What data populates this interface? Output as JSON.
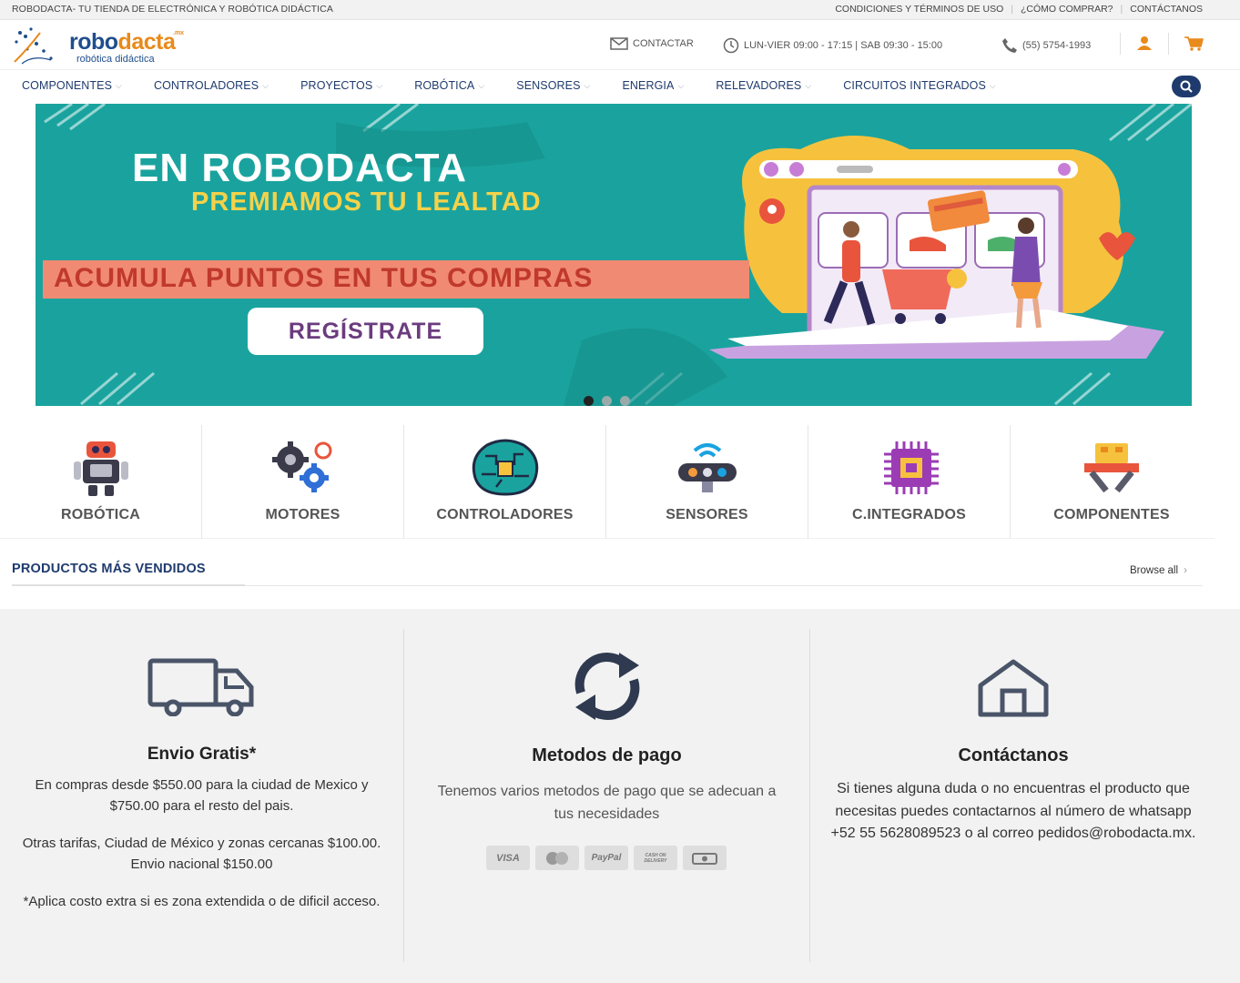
{
  "topbar": {
    "tagline": "ROBODACTA- TU TIENDA DE ELECTRÓNICA Y ROBÓTICA DIDÁCTICA",
    "links": [
      "CONDICIONES Y TÉRMINOS DE USO",
      "¿CÓMO COMPRAR?",
      "CONTÁCTANOS"
    ]
  },
  "header": {
    "logo_word_a": "robo",
    "logo_word_b": "dacta",
    "logo_tld": ".mx",
    "logo_sub": "robótica didáctica",
    "contact_label": "CONTACTAR",
    "hours": "LUN-VIER 09:00 - 17:15  | SAB 09:30 - 15:00",
    "phone": "(55) 5754-1993",
    "icons": [
      "mail-icon",
      "clock-icon",
      "phone-icon",
      "user-icon",
      "cart-icon"
    ]
  },
  "nav": {
    "items": [
      "COMPONENTES",
      "CONTROLADORES",
      "PROYECTOS",
      "ROBÓTICA",
      "SENSORES",
      "ENERGIA",
      "RELEVADORES",
      "CIRCUITOS INTEGRADOS"
    ],
    "search_icon": "search-icon"
  },
  "banner": {
    "title": "EN ROBODACTA",
    "subtitle": "PREMIAMOS TU LEALTAD",
    "strip": "ACUMULA PUNTOS EN TUS COMPRAS",
    "cta": "REGÍSTRATE",
    "slides": 3,
    "active_slide": 1,
    "colors": {
      "bg": "#1aa39e",
      "subtitle": "#f4d24a",
      "strip": "#f18a72",
      "cta_text": "#6b3c7e"
    }
  },
  "categories": [
    {
      "label": "ROBÓTICA",
      "icon": "robot-icon"
    },
    {
      "label": "MOTORES",
      "icon": "gears-icon"
    },
    {
      "label": "CONTROLADORES",
      "icon": "controller-chip-icon"
    },
    {
      "label": "SENSORES",
      "icon": "sensor-icon"
    },
    {
      "label": "C.INTEGRADOS",
      "icon": "integrated-circuit-icon"
    },
    {
      "label": "COMPONENTES",
      "icon": "components-icon"
    }
  ],
  "products": {
    "heading": "PRODUCTOS MÁS VENDIDOS",
    "browse_all": "Browse all"
  },
  "features": [
    {
      "title": "Envio Gratis*",
      "icon": "truck-icon",
      "lines": [
        "En compras desde $550.00 para la ciudad de Mexico y $750.00 para el resto del pais.",
        "Otras tarifas, Ciudad de México y zonas cercanas $100.00. Envio nacional $150.00",
        "*Aplica costo extra si es zona extendida o de dificil acceso."
      ]
    },
    {
      "title": "Metodos de pago",
      "icon": "refresh-icon",
      "lines": [
        "Tenemos varios metodos de pago que se adecuan a tus necesidades"
      ],
      "payment_methods": [
        "VISA",
        "MasterCard",
        "PayPal",
        "CASH ON DELIVERY",
        "Cash"
      ]
    },
    {
      "title": "Contáctanos",
      "icon": "home-icon",
      "lines": [
        "Si tienes alguna duda o no encuentras el producto que necesitas puedes contactarnos al número de whatsapp  +52 55 5628089523 o al correo pedidos@robodacta.mx."
      ]
    }
  ]
}
